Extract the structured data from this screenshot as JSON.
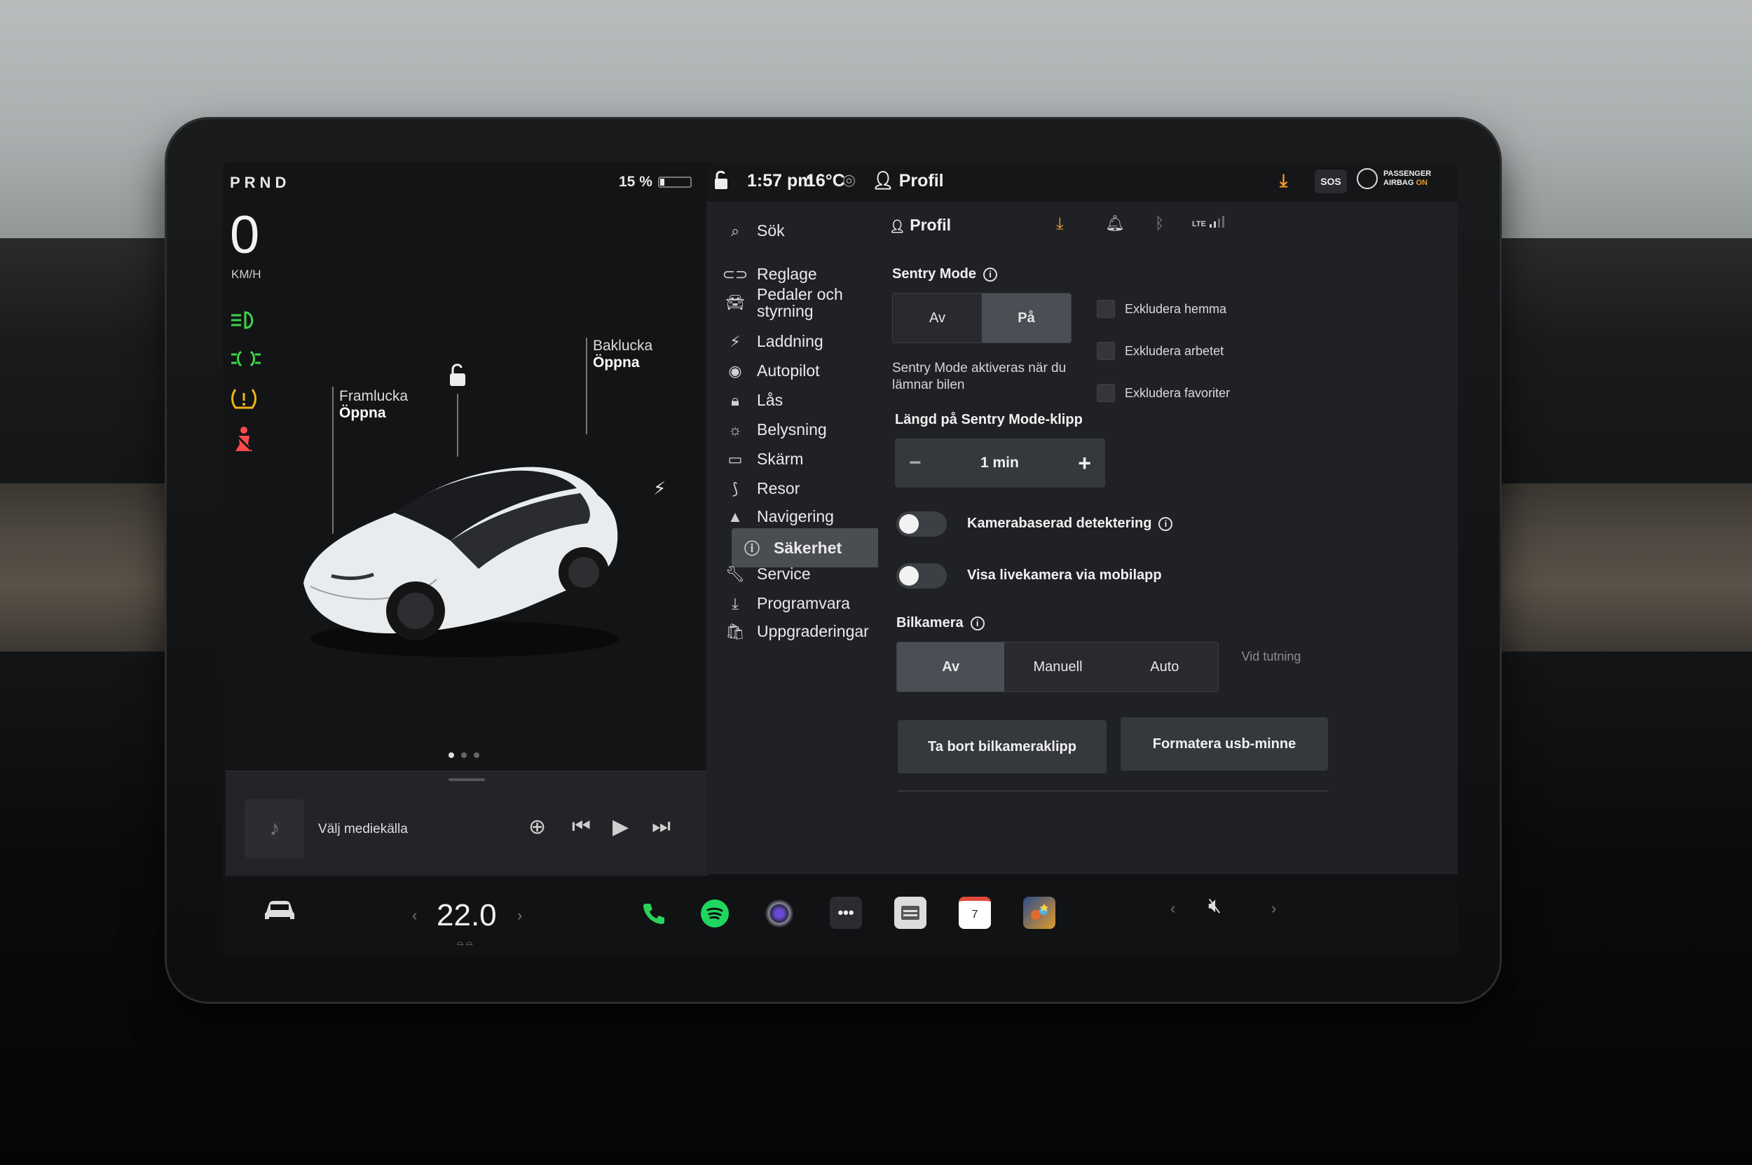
{
  "status_bar": {
    "gear": "PRND",
    "battery_percent": "15 %",
    "battery_level": 0.15,
    "time": "1:57 pm",
    "temperature": "16°C",
    "profile": "Profil",
    "sos": "SOS",
    "airbag_line1": "PASSENGER",
    "airbag_line2": "AIRBAG",
    "airbag_state": "ON"
  },
  "car_panel": {
    "speed": "0",
    "speed_unit": "KM/H",
    "frunk_label": "Framlucka",
    "frunk_action": "Öppna",
    "trunk_label": "Baklucka",
    "trunk_action": "Öppna"
  },
  "media": {
    "source_label": "Välj mediekälla"
  },
  "menu": {
    "items": [
      {
        "label": "Sök",
        "icon": "search-icon"
      },
      {
        "label": "Reglage",
        "icon": "toggle-icon"
      },
      {
        "label": "Pedaler och styrning",
        "icon": "car-icon"
      },
      {
        "label": "Laddning",
        "icon": "bolt-icon"
      },
      {
        "label": "Autopilot",
        "icon": "steering-wheel-icon"
      },
      {
        "label": "Lås",
        "icon": "lock-icon"
      },
      {
        "label": "Belysning",
        "icon": "sun-icon"
      },
      {
        "label": "Skärm",
        "icon": "display-icon"
      },
      {
        "label": "Resor",
        "icon": "trips-icon"
      },
      {
        "label": "Navigering",
        "icon": "navigation-icon"
      },
      {
        "label": "Säkerhet",
        "icon": "alert-circle-icon"
      },
      {
        "label": "Service",
        "icon": "wrench-icon"
      },
      {
        "label": "Programvara",
        "icon": "download-icon"
      },
      {
        "label": "Uppgraderingar",
        "icon": "bag-icon"
      }
    ],
    "active": "Säkerhet"
  },
  "settings": {
    "profile_title": "Profil",
    "sentry_mode_title": "Sentry Mode",
    "sentry_off": "Av",
    "sentry_on": "På",
    "sentry_desc": "Sentry Mode aktiveras när du lämnar bilen",
    "exclude_home": "Exkludera hemma",
    "exclude_work": "Exkludera arbetet",
    "exclude_favorites": "Exkludera favoriter",
    "clip_length_title": "Längd på Sentry Mode-klipp",
    "clip_length_value": "1 min",
    "camera_detection": "Kamerabaserad detektering",
    "live_camera": "Visa livekamera via mobilapp",
    "dashcam_title": "Bilkamera",
    "dashcam_options": [
      "Av",
      "Manuell",
      "Auto"
    ],
    "dashcam_selected": "Av",
    "dashcam_hint": "Vid tutning",
    "delete_clips_button": "Ta bort bilkameraklipp",
    "format_usb_button": "Formatera usb-minne",
    "lte": "LTE"
  },
  "dock": {
    "cabin_temp": "22.0",
    "apps": [
      "phone-icon",
      "spotify-icon",
      "camera-icon",
      "more-icon",
      "toybox-icon",
      "calendar-icon",
      "arcade-icon"
    ],
    "calendar_day": "7"
  },
  "colors": {
    "headlight_green": "#3fd44a",
    "tire_warning_amber": "#f2b316",
    "seatbelt_red": "#ff4a4a",
    "accent_orange": "#f29b2c",
    "spotify_green": "#1ed760",
    "phone_green": "#2ad35a"
  }
}
